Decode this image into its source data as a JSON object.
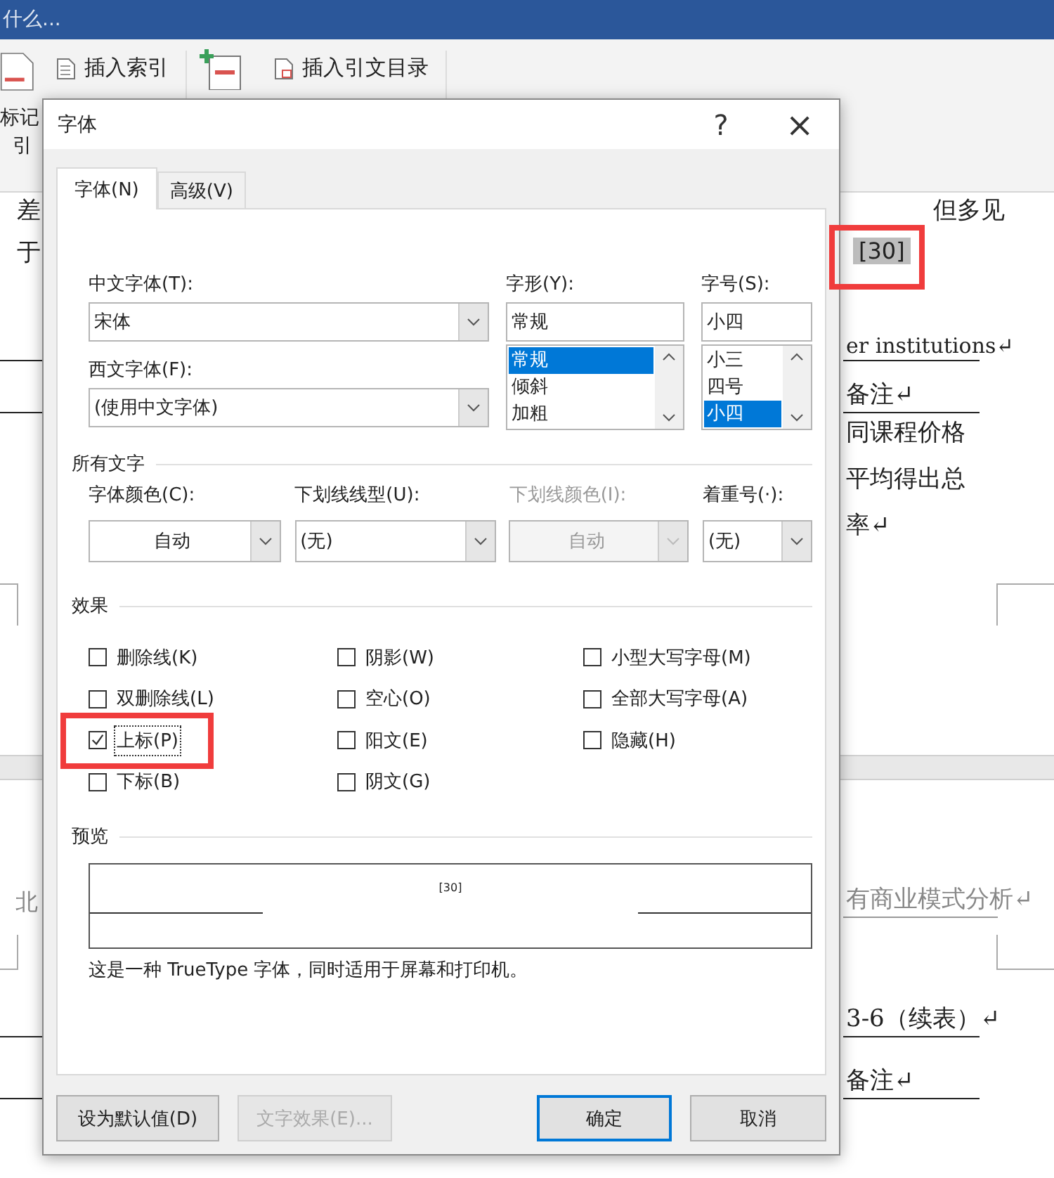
{
  "app": {
    "search_hint": "什么..."
  },
  "ribbon": {
    "mark_entry": [
      "标记",
      "引"
    ],
    "items": [
      {
        "label": "插入索引"
      },
      {
        "label": "插入引文目录"
      }
    ]
  },
  "document": {
    "page1_left": [
      "差",
      "于"
    ],
    "page1_right": [
      "但多见",
      "er institutions↵",
      "备注↵",
      "同课程价格",
      "平均得出总",
      "率↵"
    ],
    "citation": {
      "text": "[30]",
      "highlighted": true
    },
    "page2_left": [
      "北"
    ],
    "page2_right": [
      "有商业模式分析↵",
      "3-6（续表）↵",
      "备注↵"
    ]
  },
  "dialog": {
    "title": "字体",
    "help": "?",
    "close": "×",
    "tabs": [
      {
        "label": "字体(N)",
        "selected": true
      },
      {
        "label": "高级(V)",
        "selected": false
      }
    ],
    "chinese_font": {
      "label": "中文字体(T):",
      "value": "宋体"
    },
    "western_font": {
      "label": "西文字体(F):",
      "value": "(使用中文字体)"
    },
    "style": {
      "label": "字形(Y):",
      "value": "常规",
      "options": [
        {
          "label": "常规",
          "selected": true
        },
        {
          "label": "倾斜",
          "selected": false
        },
        {
          "label": "加粗",
          "selected": false
        }
      ]
    },
    "size": {
      "label": "字号(S):",
      "value": "小四",
      "options": [
        {
          "label": "小三",
          "selected": false
        },
        {
          "label": "四号",
          "selected": false
        },
        {
          "label": "小四",
          "selected": true
        }
      ]
    },
    "all_text_heading": "所有文字",
    "all_text": [
      {
        "label": "字体颜色(C):",
        "value": "自动",
        "disabled": false,
        "centered": true
      },
      {
        "label": "下划线线型(U):",
        "value": "(无)",
        "disabled": false,
        "centered": false
      },
      {
        "label": "下划线颜色(I):",
        "value": "自动",
        "disabled": true,
        "centered": true
      },
      {
        "label": "着重号(·):",
        "value": "(无)",
        "disabled": false,
        "centered": false
      }
    ],
    "effects_heading": "效果",
    "effects": [
      {
        "label": "删除线(K)",
        "checked": false
      },
      {
        "label": "双删除线(L)",
        "checked": false
      },
      {
        "label": "上标(P)",
        "checked": true
      },
      {
        "label": "下标(B)",
        "checked": false
      },
      {
        "label": "阴影(W)",
        "checked": false
      },
      {
        "label": "空心(O)",
        "checked": false
      },
      {
        "label": "阳文(E)",
        "checked": false
      },
      {
        "label": "阴文(G)",
        "checked": false
      },
      {
        "label": "小型大写字母(M)",
        "checked": false
      },
      {
        "label": "全部大写字母(A)",
        "checked": false
      },
      {
        "label": "隐藏(H)",
        "checked": false
      }
    ],
    "preview_heading": "预览",
    "preview_text": "[30]",
    "preview_note": "这是一种 TrueType 字体，同时适用于屏幕和打印机。",
    "buttons": [
      {
        "label": "设为默认值(D)",
        "kind": "default"
      },
      {
        "label": "文字效果(E)...",
        "kind": "disabled"
      },
      {
        "label": "确定",
        "kind": "primary"
      },
      {
        "label": "取消",
        "kind": "default"
      }
    ]
  }
}
